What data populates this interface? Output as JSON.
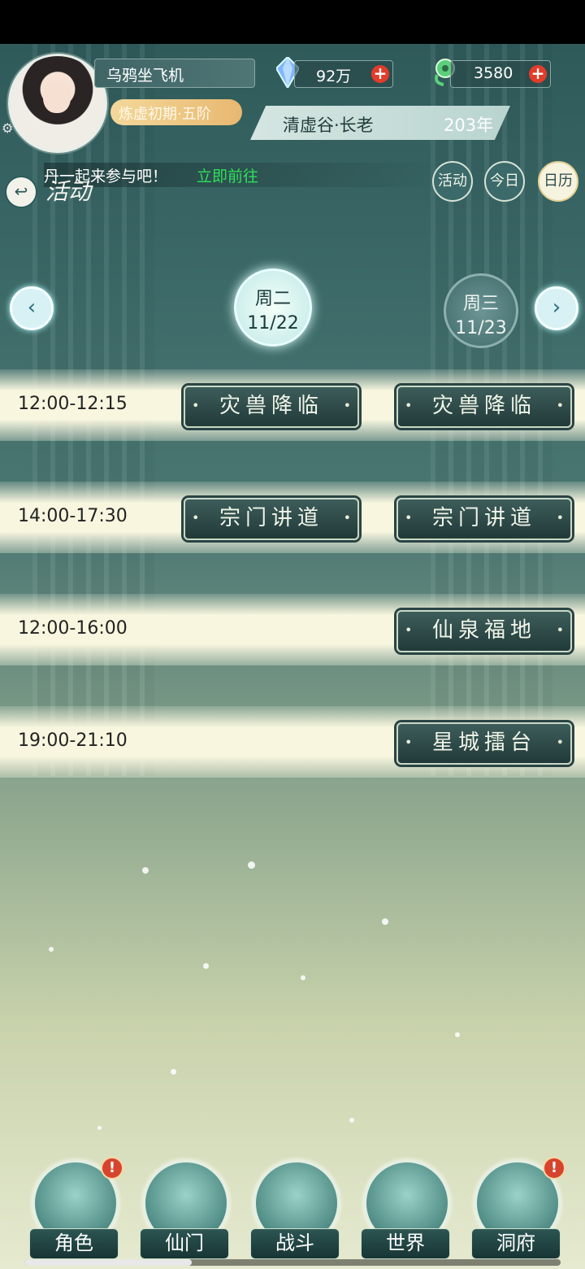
{
  "player": {
    "name": "乌鸦坐飞机",
    "realm": "炼虚初期·五阶",
    "spirit_stones": "92万",
    "jade": "3580",
    "sect_title": "清虚谷·长老",
    "age": "203年"
  },
  "notice": {
    "text": "丹一起来参与吧！",
    "link": "立即前往"
  },
  "page_title": "活动",
  "tabs": [
    {
      "label": "活动",
      "active": false
    },
    {
      "label": "今日",
      "active": false
    },
    {
      "label": "日历",
      "active": true
    }
  ],
  "days": {
    "selected": {
      "weekday": "周二",
      "date": "11/22"
    },
    "next": {
      "weekday": "周三",
      "date": "11/23"
    }
  },
  "schedule": [
    {
      "time": "12:00-12:15",
      "col1": "灾兽降临",
      "col2": "灾兽降临"
    },
    {
      "time": "14:00-17:30",
      "col1": "宗门讲道",
      "col2": "宗门讲道"
    },
    {
      "time": "12:00-16:00",
      "col1": "",
      "col2": "仙泉福地"
    },
    {
      "time": "19:00-21:10",
      "col1": "",
      "col2": "星城擂台"
    }
  ],
  "bottom_nav": [
    {
      "label": "角色",
      "badge": "!"
    },
    {
      "label": "仙门",
      "badge": ""
    },
    {
      "label": "战斗",
      "badge": ""
    },
    {
      "label": "世界",
      "badge": ""
    },
    {
      "label": "洞府",
      "badge": "!"
    }
  ],
  "colors": {
    "accent_gold": "#e8b870",
    "notice_link": "#2fe05a",
    "badge_red": "#d7442d",
    "panel_teal": "#2c5553"
  }
}
